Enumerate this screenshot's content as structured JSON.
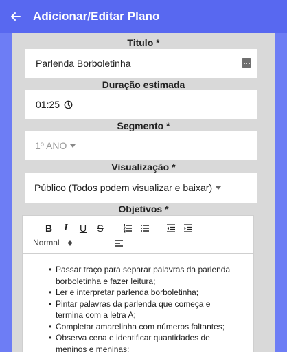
{
  "header": {
    "title": "Adicionar/Editar Plano",
    "back_icon": "arrow-left-icon"
  },
  "form": {
    "title_label": "Titulo *",
    "title_value": "Parlenda Borboletinha",
    "duration_label": "Duração estimada",
    "duration_value": "01:25",
    "segment_label": "Segmento *",
    "segment_value": "1º ANO",
    "visibility_label": "Visualização *",
    "visibility_value": "Público (Todos podem visualizar e baixar)",
    "objectives_label": "Objetivos *"
  },
  "editor": {
    "toolbar": {
      "bold": "B",
      "italic": "I",
      "underline": "U",
      "strike": "S",
      "format_value": "Normal"
    },
    "items": [
      "Passar traço para separar palavras da parlenda borboletinha e fazer leitura;",
      "Ler e interpretar parlenda borboletinha;",
      "Pintar palavras da parlenda que começa e termina com a letra A;",
      "Completar amarelinha com números faltantes;",
      "Observa cena e identificar quantidades de meninos e meninas;"
    ]
  },
  "colors": {
    "appbar": "#5868f0",
    "sides": "#6d7df5",
    "panel": "#d9d9d9"
  }
}
